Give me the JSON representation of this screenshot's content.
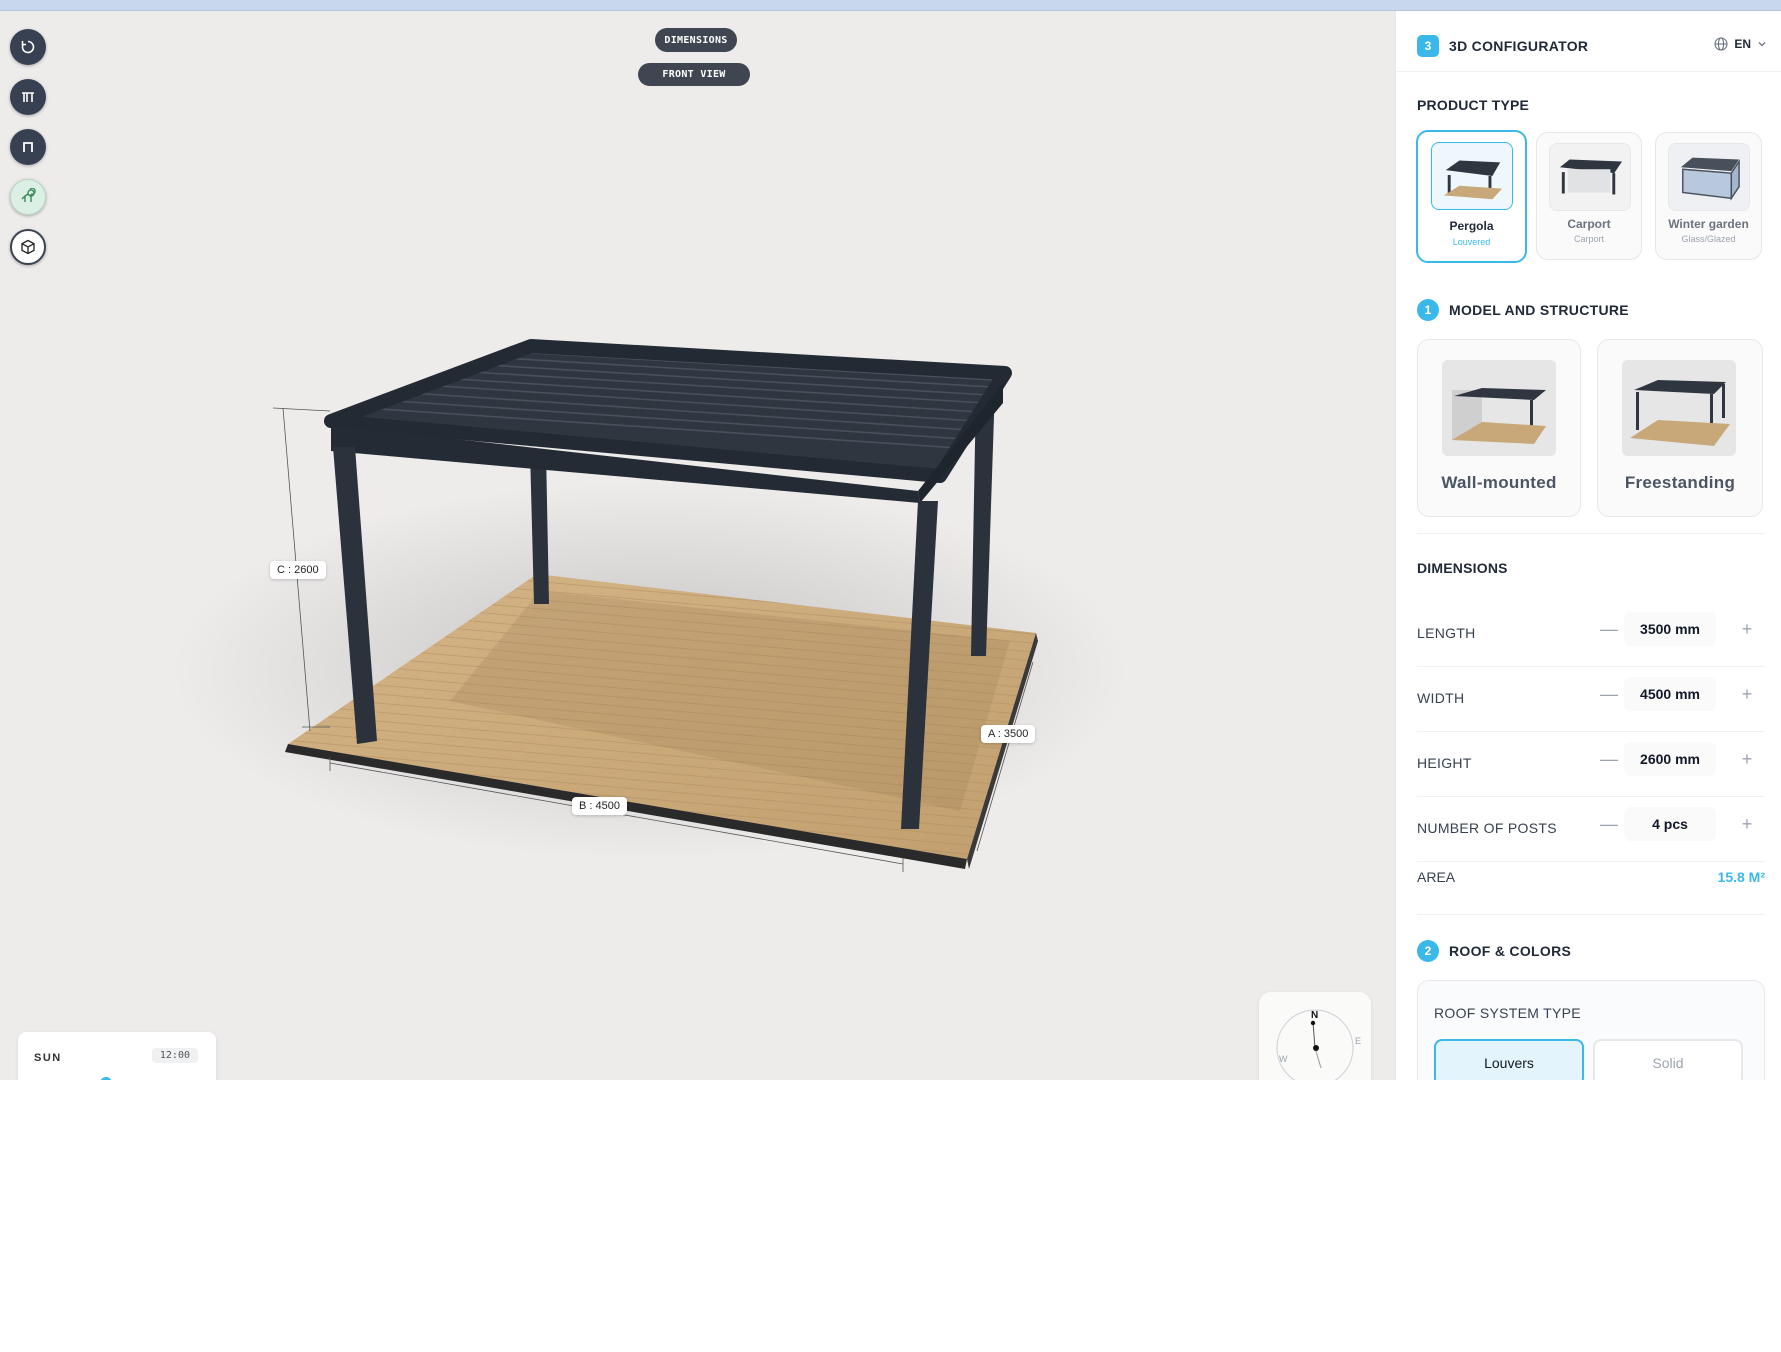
{
  "viewport": {
    "pills": {
      "dimensions": "DIMENSIONS",
      "front_view": "FRONT VIEW"
    },
    "toolbar_icons": [
      "rotate-icon",
      "table-icon",
      "arch-icon",
      "trees-icon",
      "cube-icon"
    ],
    "dimension_labels": {
      "c": "C : 2600",
      "b": "B : 4500",
      "a": "A : 3500"
    },
    "sun": {
      "label": "SUN",
      "time": "12:00"
    },
    "compass": {
      "n": "N",
      "e": "E",
      "w": "W"
    }
  },
  "panel": {
    "step_badge": "3",
    "title": "3D CONFIGURATOR",
    "language": "EN",
    "product_type": {
      "heading": "PRODUCT TYPE",
      "items": [
        {
          "name": "Pergola",
          "sub": "Louvered",
          "selected": true
        },
        {
          "name": "Carport",
          "sub": "Carport",
          "selected": false
        },
        {
          "name": "Winter garden",
          "sub": "Glass/Glazed",
          "selected": false
        }
      ]
    },
    "model": {
      "badge": "1",
      "heading": "MODEL AND STRUCTURE",
      "items": [
        {
          "name": "Wall-mounted"
        },
        {
          "name": "Freestanding"
        }
      ]
    },
    "dimensions": {
      "heading": "DIMENSIONS",
      "rows": [
        {
          "label": "LENGTH",
          "value": "3500 mm"
        },
        {
          "label": "WIDTH",
          "value": "4500 mm"
        },
        {
          "label": "HEIGHT",
          "value": "2600 mm"
        },
        {
          "label": "NUMBER OF POSTS",
          "value": "4 pcs"
        }
      ],
      "area_label": "AREA",
      "area_value": "15.8 M²"
    },
    "roof": {
      "badge": "2",
      "heading": "ROOF & COLORS",
      "system_label": "ROOF SYSTEM TYPE",
      "options": [
        "Louvers",
        "Solid"
      ],
      "selected": "Louvers"
    }
  },
  "colors": {
    "accent": "#3ab8ea",
    "frame": "#2b323c",
    "deck": "#c8a779",
    "canvas": "#eeeceb"
  }
}
